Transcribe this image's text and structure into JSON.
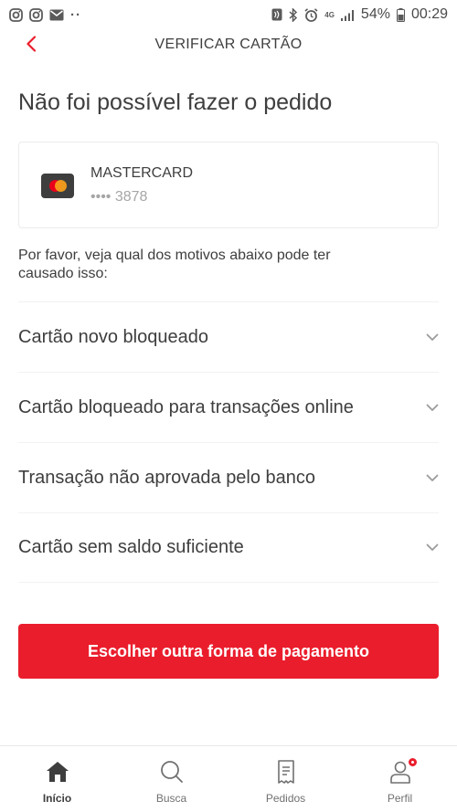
{
  "status_bar": {
    "battery_percent": "54%",
    "time": "00:29",
    "network": "4G"
  },
  "header": {
    "title": "VERIFICAR CARTÃO"
  },
  "page": {
    "title": "Não foi possível fazer o pedido"
  },
  "card": {
    "brand": "MASTERCARD",
    "number": "•••• 3878"
  },
  "hint": "Por favor, veja qual dos motivos abaixo pode ter causado isso:",
  "reasons": [
    {
      "label": "Cartão novo bloqueado"
    },
    {
      "label": "Cartão bloqueado para transações online"
    },
    {
      "label": "Transação não aprovada pelo banco"
    },
    {
      "label": "Cartão sem saldo suficiente"
    }
  ],
  "cta": {
    "label": "Escolher outra forma de pagamento"
  },
  "bottom_nav": {
    "items": [
      {
        "label": "Início",
        "icon": "home-icon",
        "active": true
      },
      {
        "label": "Busca",
        "icon": "search-icon"
      },
      {
        "label": "Pedidos",
        "icon": "orders-icon"
      },
      {
        "label": "Perfil",
        "icon": "profile-icon",
        "badge": true
      }
    ]
  },
  "colors": {
    "accent": "#ea1d2c",
    "text": "#3f3e3e",
    "muted": "#a6a6a6"
  }
}
